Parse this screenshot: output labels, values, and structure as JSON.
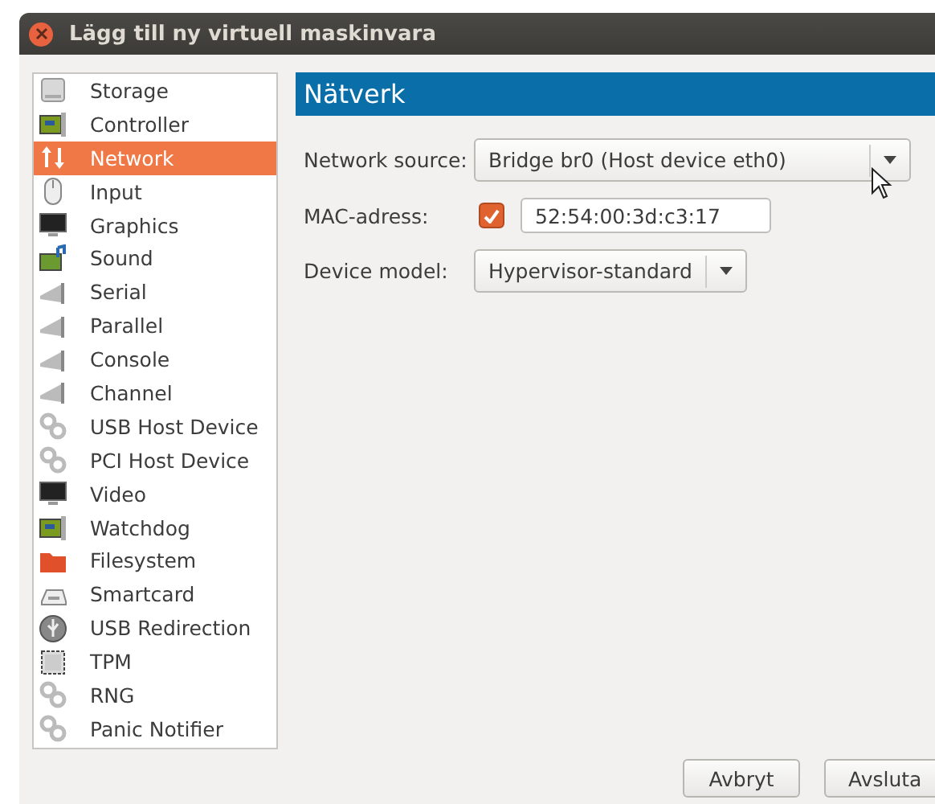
{
  "window": {
    "title": "Lägg till ny virtuell maskinvara"
  },
  "sidebar": {
    "items": [
      {
        "label": "Storage",
        "kind": "disk",
        "selected": false
      },
      {
        "label": "Controller",
        "kind": "card",
        "selected": false
      },
      {
        "label": "Network",
        "kind": "network",
        "selected": true
      },
      {
        "label": "Input",
        "kind": "mouse",
        "selected": false
      },
      {
        "label": "Graphics",
        "kind": "monitor",
        "selected": false
      },
      {
        "label": "Sound",
        "kind": "sound",
        "selected": false
      },
      {
        "label": "Serial",
        "kind": "cable",
        "selected": false
      },
      {
        "label": "Parallel",
        "kind": "cable",
        "selected": false
      },
      {
        "label": "Console",
        "kind": "cable",
        "selected": false
      },
      {
        "label": "Channel",
        "kind": "cable",
        "selected": false
      },
      {
        "label": "USB Host Device",
        "kind": "gears",
        "selected": false
      },
      {
        "label": "PCI Host Device",
        "kind": "gears",
        "selected": false
      },
      {
        "label": "Video",
        "kind": "monitor",
        "selected": false
      },
      {
        "label": "Watchdog",
        "kind": "card",
        "selected": false
      },
      {
        "label": "Filesystem",
        "kind": "folder",
        "selected": false
      },
      {
        "label": "Smartcard",
        "kind": "smartcard",
        "selected": false
      },
      {
        "label": "USB Redirection",
        "kind": "usb",
        "selected": false
      },
      {
        "label": "TPM",
        "kind": "chip",
        "selected": false
      },
      {
        "label": "RNG",
        "kind": "gears",
        "selected": false
      },
      {
        "label": "Panic Notifier",
        "kind": "gears",
        "selected": false
      }
    ]
  },
  "panel": {
    "header": "Nätverk",
    "network_source": {
      "label": "Network source:",
      "value": "Bridge br0 (Host device eth0)"
    },
    "mac_address": {
      "label": "MAC-adress:",
      "checked": true,
      "value": "52:54:00:3d:c3:17"
    },
    "device_model": {
      "label": "Device model:",
      "value": "Hypervisor-standard"
    }
  },
  "buttons": [
    "Avbryt",
    "Avsluta"
  ]
}
